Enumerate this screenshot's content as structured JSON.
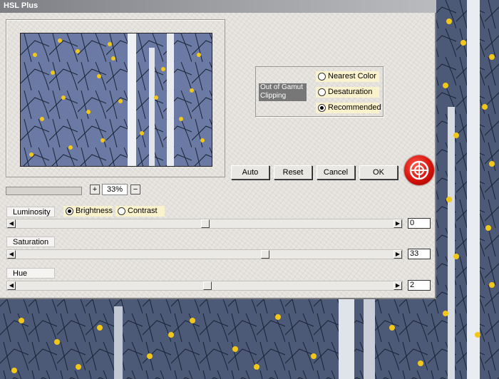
{
  "window": {
    "title": "HSL Plus"
  },
  "gamut": {
    "label": "Out of Gamut Clipping",
    "options": [
      {
        "label": "Nearest Color",
        "selected": false
      },
      {
        "label": "Desaturation",
        "selected": false
      },
      {
        "label": "Recommended",
        "selected": true
      }
    ]
  },
  "buttons": {
    "auto": "Auto",
    "reset": "Reset",
    "cancel": "Cancel",
    "ok": "OK"
  },
  "zoom": {
    "plus": "+",
    "minus": "−",
    "value": "33%"
  },
  "luminosity": {
    "label": "Luminosity",
    "modes": [
      {
        "label": "Brightness",
        "selected": true
      },
      {
        "label": "Contrast",
        "selected": false
      }
    ],
    "value": "0"
  },
  "saturation": {
    "label": "Saturation",
    "value": "33"
  },
  "hue": {
    "label": "Hue",
    "value": "2"
  },
  "colors": {
    "accent": "#d7110a",
    "radio_bg": "#faf2cc",
    "title_bar": "#8e9094"
  }
}
